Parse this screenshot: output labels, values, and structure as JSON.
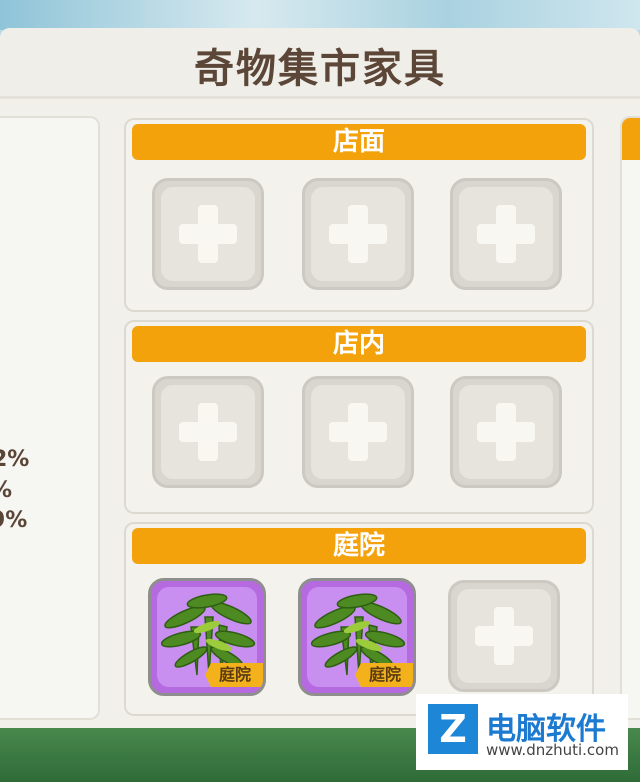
{
  "title": "奇物集市家具",
  "left_stats": [
    "2%",
    "%",
    "9%"
  ],
  "sections": [
    {
      "name": "店面",
      "slots": [
        "empty",
        "empty",
        "empty"
      ]
    },
    {
      "name": "店内",
      "slots": [
        "empty",
        "empty",
        "empty"
      ]
    },
    {
      "name": "庭院",
      "slots": [
        {
          "type": "item",
          "icon": "bamboo-plant-icon",
          "tag": "庭院"
        },
        {
          "type": "item",
          "icon": "bamboo-plant-icon",
          "tag": "庭院"
        },
        "empty"
      ]
    }
  ],
  "colors": {
    "header": "#f3a20c",
    "item_bg": "#b56ae0",
    "title": "#5b4637"
  },
  "watermark": {
    "name": "电脑软件",
    "url": "www.dnzhuti.com",
    "logo": "Z"
  }
}
